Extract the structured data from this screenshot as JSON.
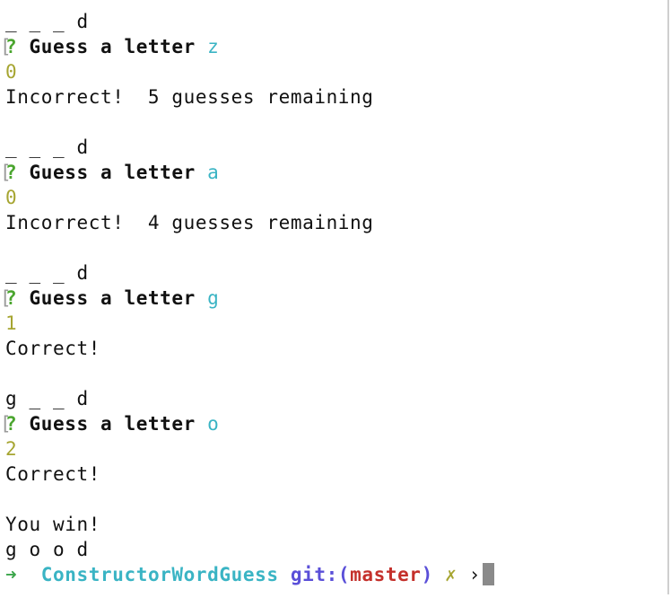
{
  "rounds": [
    {
      "word_state": "_ _ _ d",
      "prompt_mark": "?",
      "prompt_label": "Guess a letter",
      "guess": "z",
      "index": "0",
      "result": "Incorrect!  5 guesses remaining"
    },
    {
      "word_state": "_ _ _ d",
      "prompt_mark": "?",
      "prompt_label": "Guess a letter",
      "guess": "a",
      "index": "0",
      "result": "Incorrect!  4 guesses remaining"
    },
    {
      "word_state": "_ _ _ d",
      "prompt_mark": "?",
      "prompt_label": "Guess a letter",
      "guess": "g",
      "index": "1",
      "result": "Correct!"
    },
    {
      "word_state": "g _ _ d",
      "prompt_mark": "?",
      "prompt_label": "Guess a letter",
      "guess": "o",
      "index": "2",
      "result": "Correct!"
    }
  ],
  "ending": {
    "message": "You win!",
    "word": "g o o d"
  },
  "shell_prompt": {
    "arrow": "➜",
    "directory": "ConstructorWordGuess",
    "git_label": "git:(",
    "branch": "master",
    "git_close": ")",
    "dirty_mark": "✗",
    "caret": "›"
  },
  "colors": {
    "answer": "#3ab4c4",
    "index": "#a6a531",
    "question_mark": "#4aa52e",
    "branch": "#c4302b",
    "git": "#5a4fd8"
  }
}
